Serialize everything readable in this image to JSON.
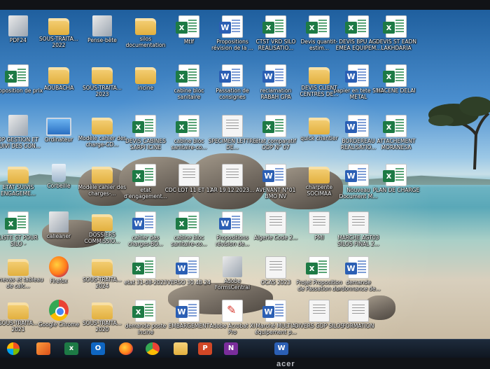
{
  "brand": "acer",
  "desktop_icons": [
    {
      "label": "PDF24",
      "type": "app"
    },
    {
      "label": "SOUS-TRAITA... 2022",
      "type": "folder"
    },
    {
      "label": "Pense-bête",
      "type": "app"
    },
    {
      "label": "silos documentation",
      "type": "folder"
    },
    {
      "label": "Mtlf",
      "type": "excel"
    },
    {
      "label": "Propositions révision de la ...",
      "type": "word"
    },
    {
      "label": "CTST VRD SILO REALISATIO...",
      "type": "excel"
    },
    {
      "label": "Devis quantit-estim...",
      "type": "excel"
    },
    {
      "label": "DEVIS BPU AGI EMEA EQUIPEM...",
      "type": "excel"
    },
    {
      "label": "DEVIS ST EADN LAKHDARIA",
      "type": "excel"
    },
    {
      "label": "proposition de prix",
      "type": "excel"
    },
    {
      "label": "AOUBACHA",
      "type": "folder"
    },
    {
      "label": "SOUS-TRAITA... 2023",
      "type": "folder"
    },
    {
      "label": "incine",
      "type": "folder"
    },
    {
      "label": "cabine bloc sanitaire",
      "type": "excel"
    },
    {
      "label": "Passation de consignes",
      "type": "word"
    },
    {
      "label": "reclamation RABAH GPA",
      "type": "word"
    },
    {
      "label": "DEVIS CLIENT CENTRES DE...",
      "type": "folder"
    },
    {
      "label": "papier en tete SNC METAL",
      "type": "word"
    },
    {
      "label": "HACENE DELAI",
      "type": "excel"
    },
    {
      "label": "DP GESTION ET SUIVI DES CON...",
      "type": "app"
    },
    {
      "label": "Ordinateur",
      "type": "pc"
    },
    {
      "label": "Modèle cahier des charge-CD...",
      "type": "folder"
    },
    {
      "label": "DEVIS CABINES SARPI ICINE",
      "type": "excel"
    },
    {
      "label": "cabine bloc sanitaire-co...",
      "type": "excel"
    },
    {
      "label": "SPECIMEN LETTRE DE...",
      "type": "doc"
    },
    {
      "label": "état comparatif ODP N° 07",
      "type": "excel"
    },
    {
      "label": "quick chantier",
      "type": "folder"
    },
    {
      "label": "BORDEREAU REALISATIO...",
      "type": "word"
    },
    {
      "label": "ATTACHEMENT MORANESA",
      "type": "excel"
    },
    {
      "label": "ETAT SUIVIS ENGAGEME...",
      "type": "folder"
    },
    {
      "label": "Corbeille",
      "type": "bin"
    },
    {
      "label": "Modèle cahier des charges-...",
      "type": "folder"
    },
    {
      "label": "etat d'engagement...",
      "type": "excel"
    },
    {
      "label": "CDC LOT 11 ET 12",
      "type": "doc"
    },
    {
      "label": "AR 19.12.2023...",
      "type": "doc"
    },
    {
      "label": "AVENANT N°01 BMO NV",
      "type": "word"
    },
    {
      "label": "charpente SOCIMAA",
      "type": "folder"
    },
    {
      "label": "Nouveau Document M...",
      "type": "word"
    },
    {
      "label": "PLAN DE CHARGE",
      "type": "excel"
    },
    {
      "label": "LISTE ST POUR SILO -",
      "type": "excel"
    },
    {
      "label": "calleaner",
      "type": "app"
    },
    {
      "label": "DOSSIERS COMMISSIO...",
      "type": "folder"
    },
    {
      "label": "cahier des charges-BO...",
      "type": "word"
    },
    {
      "label": "cabine bloc sanitaire-co...",
      "type": "excel"
    },
    {
      "label": "Propositions révision de...",
      "type": "word"
    },
    {
      "label": "Algerie Code 2...",
      "type": "doc"
    },
    {
      "label": "PMI",
      "type": "doc"
    },
    {
      "label": "MARCHE AGT03 SILOS FINAL 2...",
      "type": "doc"
    },
    {
      "label": "canevas et tableau de calc...",
      "type": "folder"
    },
    {
      "label": "Firefox",
      "type": "firefox"
    },
    {
      "label": "SOUS-TRAITA... 2024",
      "type": "folder"
    },
    {
      "label": "etat 31-08-2023",
      "type": "excel"
    },
    {
      "label": "VERSO 30 4B 24",
      "type": "word"
    },
    {
      "label": "Adobe FormsCentral",
      "type": "app"
    },
    {
      "label": "OCAS 2023",
      "type": "doc"
    },
    {
      "label": "Projet Proposition de Passation d...",
      "type": "excel"
    },
    {
      "label": "demande ordonnance de...",
      "type": "word"
    },
    {
      "label": "SOUS-TRAITA... 2021",
      "type": "folder"
    },
    {
      "label": "Google Chrome",
      "type": "chrome"
    },
    {
      "label": "SOUS-TRAITA... 2020",
      "type": "folder"
    },
    {
      "label": "demande poste incine",
      "type": "excel"
    },
    {
      "label": "EMBARGEMENT",
      "type": "word"
    },
    {
      "label": "Adobe Acrobat XI Pro",
      "type": "pdf"
    },
    {
      "label": "Marché MULTIA équipement p...",
      "type": "word"
    },
    {
      "label": "DIVERS GDP SILOS",
      "type": "doc"
    },
    {
      "label": "FORMATION",
      "type": "doc"
    }
  ]
}
